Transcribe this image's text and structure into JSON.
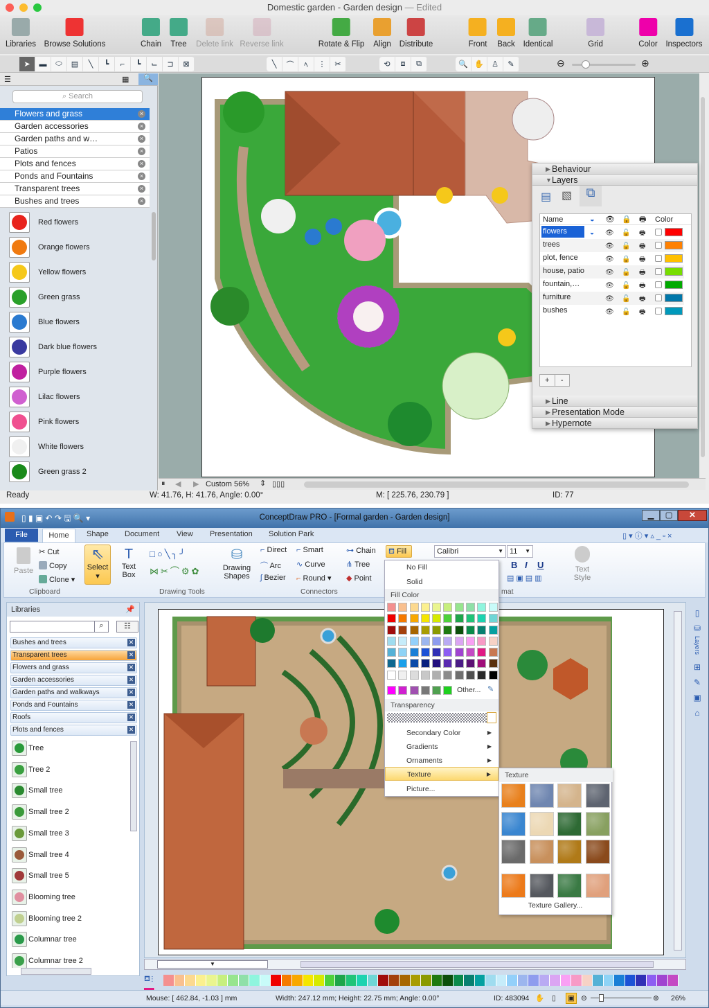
{
  "mac_window": {
    "title": "Domestic garden - Garden design",
    "edited": "— Edited",
    "toolbar": [
      {
        "label": "Libraries",
        "icon": "libraries-icon",
        "enabled": true
      },
      {
        "label": "Browse Solutions",
        "icon": "browse-solutions-icon",
        "enabled": true
      },
      {
        "label": "Chain",
        "icon": "chain-icon",
        "enabled": true
      },
      {
        "label": "Tree",
        "icon": "tree-icon",
        "enabled": true
      },
      {
        "label": "Delete link",
        "icon": "delete-link-icon",
        "enabled": false
      },
      {
        "label": "Reverse link",
        "icon": "reverse-link-icon",
        "enabled": false
      },
      {
        "label": "Rotate & Flip",
        "icon": "rotate-flip-icon",
        "enabled": true
      },
      {
        "label": "Align",
        "icon": "align-icon",
        "enabled": true
      },
      {
        "label": "Distribute",
        "icon": "distribute-icon",
        "enabled": true
      },
      {
        "label": "Front",
        "icon": "front-icon",
        "enabled": true
      },
      {
        "label": "Back",
        "icon": "back-icon",
        "enabled": true
      },
      {
        "label": "Identical",
        "icon": "identical-icon",
        "enabled": true
      },
      {
        "label": "Grid",
        "icon": "grid-icon",
        "enabled": true
      },
      {
        "label": "Color",
        "icon": "color-wheel-icon",
        "enabled": true
      },
      {
        "label": "Inspectors",
        "icon": "info-icon",
        "enabled": true
      }
    ],
    "search_placeholder": "Search",
    "libraries": [
      "Flowers and grass",
      "Garden accessories",
      "Garden paths and w…",
      "Patios",
      "Plots and fences",
      "Ponds and Fountains",
      "Transparent trees",
      "Bushes and trees"
    ],
    "selected_library": "Flowers and grass",
    "shapes": [
      {
        "label": "Red flowers",
        "color": "#e8231c"
      },
      {
        "label": "Orange flowers",
        "color": "#f07a10"
      },
      {
        "label": "Yellow flowers",
        "color": "#f5c81a"
      },
      {
        "label": "Green grass",
        "color": "#2aa02a"
      },
      {
        "label": "Blue flowers",
        "color": "#2a7ad0"
      },
      {
        "label": "Dark blue flowers",
        "color": "#3a3aa0"
      },
      {
        "label": "Purple flowers",
        "color": "#c020a0"
      },
      {
        "label": "Lilac flowers",
        "color": "#d060d0"
      },
      {
        "label": "Pink flowers",
        "color": "#f05090"
      },
      {
        "label": "White flowers",
        "color": "#f0f0f0"
      },
      {
        "label": "Green grass 2",
        "color": "#1a8a1a"
      }
    ],
    "zoom": "Custom 56%",
    "status": {
      "ready": "Ready",
      "size": "W: 41.76,  H: 41.76,  Angle: 0.00°",
      "mouse": "M: [ 225.76, 230.79 ]",
      "id": "ID: 77"
    },
    "inspector": {
      "sections_top": [
        "Behaviour",
        "Layers"
      ],
      "columns": {
        "name": "Name",
        "color": "Color"
      },
      "layers": [
        {
          "name": "flowers",
          "color": "#ff0000",
          "locked": false,
          "active": true
        },
        {
          "name": "trees",
          "color": "#ff8000",
          "locked": false,
          "active": false
        },
        {
          "name": "plot, fence",
          "color": "#ffc000",
          "locked": true,
          "active": false
        },
        {
          "name": "house, patio",
          "color": "#77dd00",
          "locked": false,
          "active": false
        },
        {
          "name": "fountain,…",
          "color": "#00aa00",
          "locked": false,
          "active": false
        },
        {
          "name": "furniture",
          "color": "#0077aa",
          "locked": false,
          "active": false
        },
        {
          "name": "bushes",
          "color": "#0099bb",
          "locked": false,
          "active": false
        }
      ],
      "add": "+",
      "remove": "-",
      "sections_bottom": [
        "Line",
        "Presentation Mode",
        "Hypernote"
      ]
    }
  },
  "win_window": {
    "title": "ConceptDraw PRO - [Formal garden - Garden design]",
    "tabs": [
      "File",
      "Home",
      "Shape",
      "Document",
      "View",
      "Presentation",
      "Solution Park"
    ],
    "active_tab": "Home",
    "ribbon": {
      "paste": "Paste",
      "cut": "Cut",
      "copy": "Copy",
      "clone": "Clone",
      "clipboard": "Clipboard",
      "select": "Select",
      "text_box": "Text Box",
      "drawing_tools": "Drawing Tools",
      "drawing_shapes": "Drawing Shapes",
      "connectors": [
        "Direct",
        "Smart",
        "Arc",
        "Curve",
        "Bezier",
        "Round"
      ],
      "connectors_label": "Connectors",
      "chain": "Chain",
      "tree": "Tree",
      "point": "Point",
      "fill": "Fill",
      "font": "Calibri",
      "font_size": "11",
      "bold": "B",
      "italic": "I",
      "underline": "U",
      "format_label": "mat",
      "text_style": "Text Style"
    },
    "libraries_title": "Libraries",
    "libraries": [
      "Bushes and trees",
      "Transparent trees",
      "Flowers and grass",
      "Garden accessories",
      "Garden paths and walkways",
      "Ponds and Fountains",
      "Roofs",
      "Plots and fences"
    ],
    "selected_library": "Transparent trees",
    "shapes": [
      {
        "label": "Tree",
        "color": "#2a9a3a"
      },
      {
        "label": "Tree 2",
        "color": "#3aa040"
      },
      {
        "label": "Small tree",
        "color": "#2a8a30"
      },
      {
        "label": "Small tree 2",
        "color": "#3a9a3a"
      },
      {
        "label": "Small tree 3",
        "color": "#6a9a3a"
      },
      {
        "label": "Small tree 4",
        "color": "#9a5a3a"
      },
      {
        "label": "Small tree 5",
        "color": "#a03a3a"
      },
      {
        "label": "Blooming tree",
        "color": "#e090a0"
      },
      {
        "label": "Blooming tree 2",
        "color": "#c0d090"
      },
      {
        "label": "Columnar tree",
        "color": "#2a9a4a"
      },
      {
        "label": "Columnar tree 2",
        "color": "#3aa04a"
      }
    ],
    "fill_menu": {
      "no_fill": "No Fill",
      "solid": "Solid",
      "fill_color": "Fill Color",
      "colors": [
        "#f4908f",
        "#f9c08f",
        "#fcd98f",
        "#fbf08f",
        "#eaf58f",
        "#c7ef7e",
        "#97e58e",
        "#8fe0a8",
        "#8ff5de",
        "#c8fbf9",
        "#f00000",
        "#f57a00",
        "#f8a800",
        "#f5e600",
        "#d6ea00",
        "#4ed13a",
        "#1ea54a",
        "#20c478",
        "#1dd3b0",
        "#6fd6d6",
        "#a00c0c",
        "#a3400c",
        "#a76600",
        "#a89c00",
        "#8a9a00",
        "#1e7a10",
        "#0b4f0b",
        "#0a8a4a",
        "#088070",
        "#05a0a0",
        "#9fdcef",
        "#c6ecfa",
        "#93d0fa",
        "#9cb6ee",
        "#8e9cee",
        "#b9aaf3",
        "#dba5f3",
        "#f9a0f4",
        "#f79ac6",
        "#f7d2c6",
        "#55b1d6",
        "#8fd3f6",
        "#1a7fd6",
        "#1c52d6",
        "#3030b5",
        "#8c5ef2",
        "#a044d0",
        "#c44ac4",
        "#e01a84",
        "#c87852",
        "#0e6890",
        "#1aa0ea",
        "#0a4aa8",
        "#08207e",
        "#22107e",
        "#5a2ab0",
        "#4a1c86",
        "#5c1274",
        "#a00e7a",
        "#5a300e",
        "#ffffff",
        "#f0f0f0",
        "#dcdcdc",
        "#c8c8c8",
        "#b0b0b0",
        "#8c8c8c",
        "#707070",
        "#505050",
        "#2a2a2a",
        "#000000"
      ],
      "recent_colors": [
        "#ff00ff",
        "#d020d0",
        "#a050b0",
        "#787878",
        "#50a050",
        "#20d020"
      ],
      "other": "Other...",
      "transparency": "Transparency",
      "items": [
        "Secondary Color",
        "Gradients",
        "Ornaments",
        "Texture",
        "Picture..."
      ],
      "highlighted": "Texture"
    },
    "texture_menu": {
      "title": "Texture",
      "textures": [
        "#e8801c",
        "#6f86b0",
        "#d4b48c",
        "#5e6470",
        "#3a86d0",
        "#ecd8b4",
        "#2e6a34",
        "#88a060",
        "#6a6a6a",
        "#c8905c",
        "#b07a18",
        "#8a4a1c",
        "#ec7a1a",
        "#55585e",
        "#3a7a44",
        "#e0a07c"
      ],
      "gallery": "Texture Gallery..."
    },
    "palette": [
      "#f4908f",
      "#f9c08f",
      "#fcd98f",
      "#fbf08f",
      "#eaf58f",
      "#c7ef7e",
      "#97e58e",
      "#8fe0a8",
      "#8ff5de",
      "#c8fbf9",
      "#f00000",
      "#f57a00",
      "#f8a800",
      "#f5e600",
      "#d6ea00",
      "#4ed13a",
      "#1ea54a",
      "#20c478",
      "#1dd3b0",
      "#6fd6d6",
      "#a00c0c",
      "#a3400c",
      "#a76600",
      "#a89c00",
      "#8a9a00",
      "#1e7a10",
      "#0b4f0b",
      "#0a8a4a",
      "#088070",
      "#05a0a0",
      "#9fdcef",
      "#c6ecfa",
      "#93d0fa",
      "#9cb6ee",
      "#8e9cee",
      "#b9aaf3",
      "#dba5f3",
      "#f9a0f4",
      "#f79ac6",
      "#f7d2c6",
      "#55b1d6",
      "#8fd3f6",
      "#1a7fd6",
      "#1c52d6",
      "#3030b5",
      "#8c5ef2",
      "#a044d0",
      "#c44ac4",
      "#e01a84"
    ],
    "status": {
      "mouse": "Mouse: [ 462.84, -1.03 ] mm",
      "size": "Width: 247.12 mm;  Height: 22.75 mm;  Angle: 0.00°",
      "id": "ID: 483094",
      "zoom": "26%"
    }
  }
}
